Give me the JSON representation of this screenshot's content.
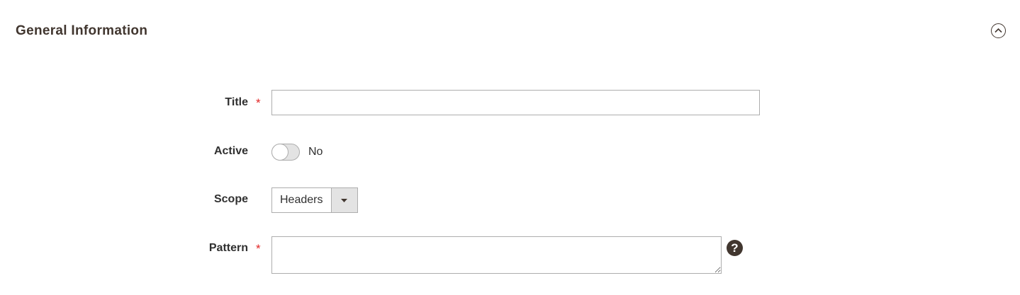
{
  "section": {
    "title": "General Information"
  },
  "fields": {
    "title": {
      "label": "Title",
      "required_mark": "*",
      "value": ""
    },
    "active": {
      "label": "Active",
      "state_text": "No",
      "checked": false
    },
    "scope": {
      "label": "Scope",
      "selected": "Headers"
    },
    "pattern": {
      "label": "Pattern",
      "required_mark": "*",
      "value": "",
      "help_symbol": "?"
    }
  },
  "icons": {
    "collapse": "chevron-up-circle-icon",
    "dropdown": "caret-down-icon",
    "help": "question-circle-icon"
  },
  "colors": {
    "heading": "#41362f",
    "required": "#e22626",
    "border": "#adadad",
    "toggle_bg": "#e3e3e3"
  }
}
